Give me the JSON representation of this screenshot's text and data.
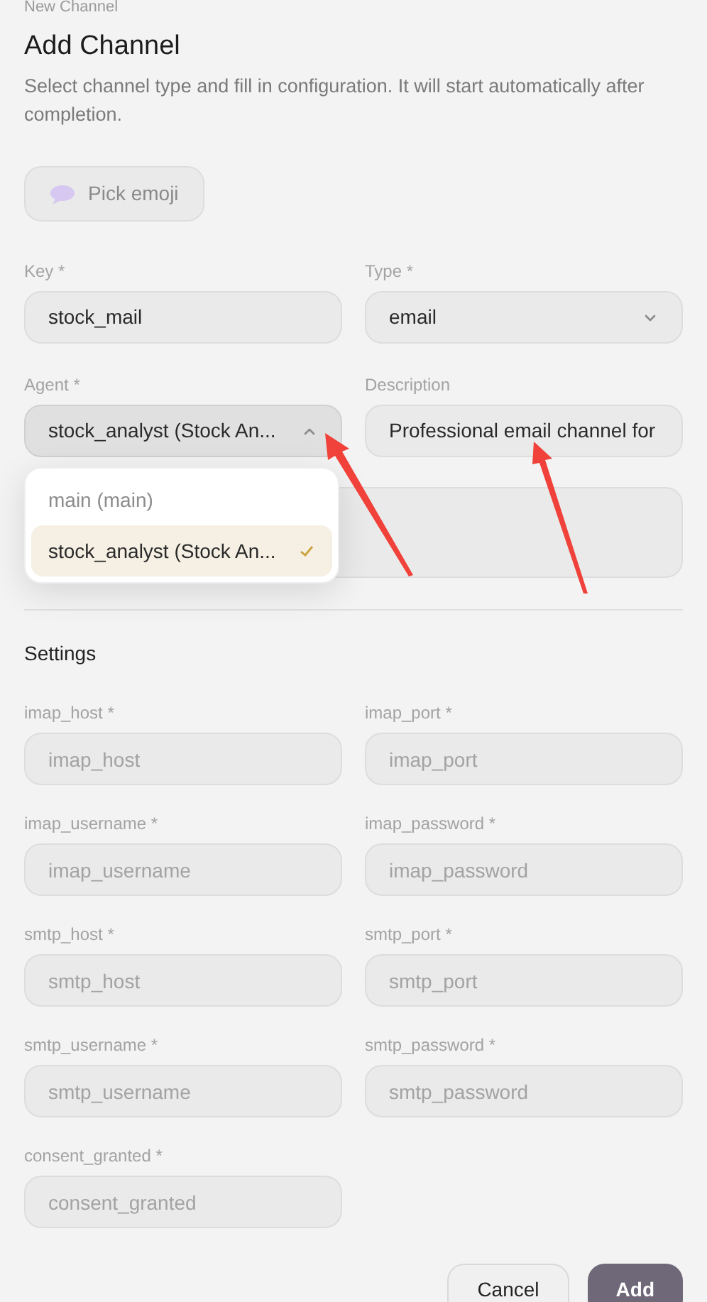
{
  "breadcrumb": "New Channel",
  "title": "Add Channel",
  "description": "Select channel type and fill in configuration. It will start automatically after completion.",
  "emoji_button": "Pick emoji",
  "main_fields": [
    {
      "kind": "text",
      "label": "Key *",
      "value": "stock_mail"
    },
    {
      "kind": "select",
      "label": "Type *",
      "value": "email",
      "expanded": false
    },
    {
      "kind": "select",
      "label": "Agent *",
      "value": "stock_analyst (Stock An...",
      "expanded": true,
      "options": [
        {
          "label": "main (main)",
          "selected": false
        },
        {
          "label": "stock_analyst (Stock An...",
          "selected": true
        }
      ]
    },
    {
      "kind": "text",
      "label": "Description",
      "value": "Professional email channel for"
    }
  ],
  "settings_title": "Settings",
  "settings_fields": [
    {
      "label": "imap_host *",
      "placeholder": "imap_host"
    },
    {
      "label": "imap_port *",
      "placeholder": "imap_port"
    },
    {
      "label": "imap_username *",
      "placeholder": "imap_username"
    },
    {
      "label": "imap_password *",
      "placeholder": "imap_password"
    },
    {
      "label": "smtp_host *",
      "placeholder": "smtp_host"
    },
    {
      "label": "smtp_port *",
      "placeholder": "smtp_port"
    },
    {
      "label": "smtp_username *",
      "placeholder": "smtp_username"
    },
    {
      "label": "smtp_password *",
      "placeholder": "smtp_password"
    },
    {
      "label": "consent_granted *",
      "placeholder": "consent_granted"
    }
  ],
  "buttons": [
    {
      "kind": "secondary",
      "label": "Cancel"
    },
    {
      "kind": "primary",
      "label": "Add"
    }
  ]
}
